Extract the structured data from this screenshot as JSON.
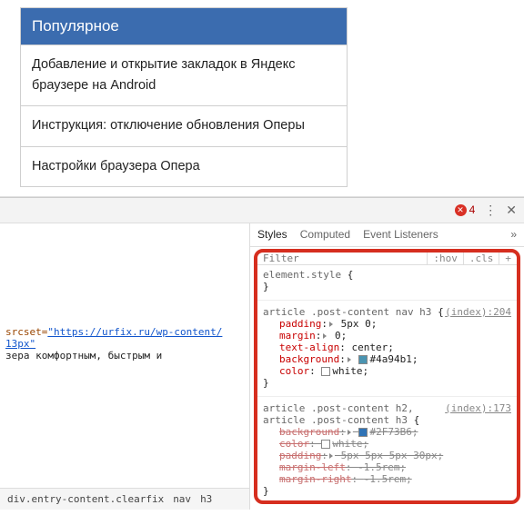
{
  "page": {
    "widget_header": "Популярное",
    "items": [
      "Добавление и открытие закладок в Яндекс браузере на Android",
      "Инструкция: отключение обновления Оперы",
      "Настройки браузера Опера"
    ]
  },
  "devtools": {
    "errors": "4",
    "tabs": {
      "styles": "Styles",
      "computed": "Computed",
      "listeners": "Event Listeners"
    },
    "filter_placeholder": "Filter",
    "hov": ":hov",
    "cls": ".cls",
    "plus": "+",
    "source": {
      "attr_name": "srcset=",
      "attr_val": "\"https://urfix.ru/wp-content/",
      "line2": "13px\"",
      "text_line": "зера комфортным, быстрым и"
    },
    "breadcrumbs": {
      "c1": "div.entry-content.clearfix",
      "c2": "nav",
      "c3": "h3"
    },
    "rules": {
      "r0": {
        "selector": "element.style",
        "open": "{",
        "close": "}"
      },
      "r1": {
        "selector": "article .post-content nav h3",
        "open": "{",
        "link": "(index):204",
        "p1": "padding",
        "v1": "5px 0",
        "p2": "margin",
        "v2": "0",
        "p3": "text-align",
        "v3": "center",
        "p4": "background",
        "v4": "#4a94b1",
        "p5": "color",
        "v5": "white",
        "close": "}"
      },
      "r2": {
        "selector": "article .post-content h2, article .post-content h3",
        "open": "{",
        "link": "(index):173",
        "p1": "background",
        "v1": "#2F73B6",
        "p2": "color",
        "v2": "white",
        "p3": "padding",
        "v3": "5px 5px 5px 30px",
        "p4": "margin-left",
        "v4": "-1.5rem",
        "p5": "margin-right",
        "v5": "-1.5rem",
        "close": "}"
      }
    }
  }
}
